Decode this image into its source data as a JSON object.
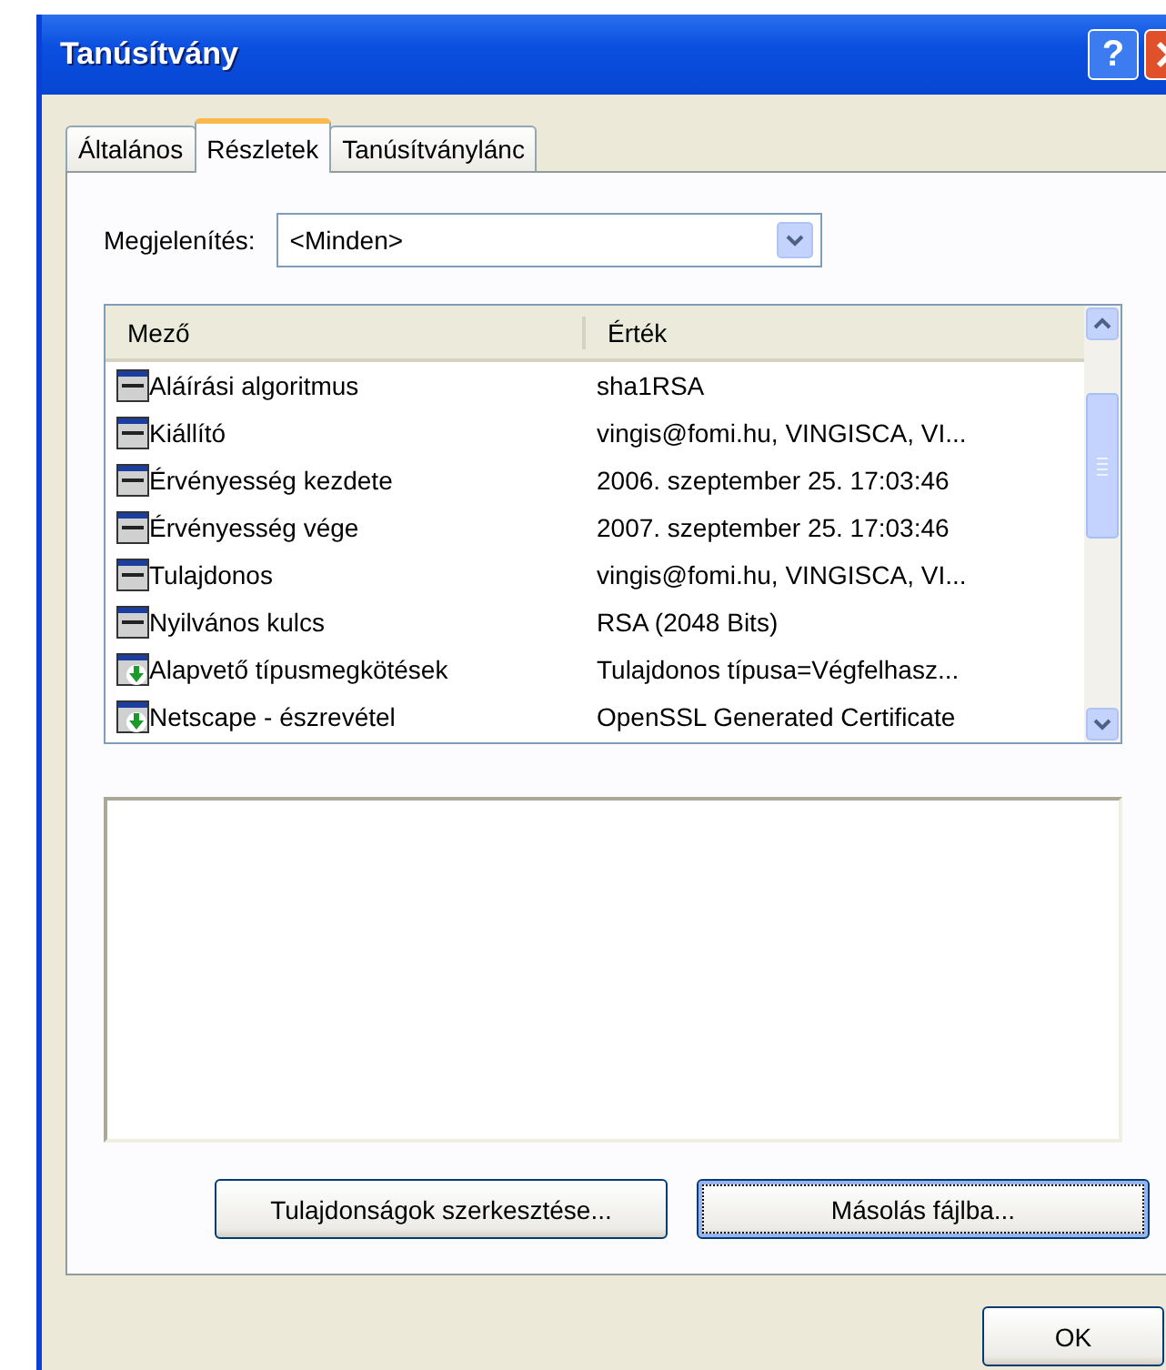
{
  "window": {
    "title": "Tanúsítvány"
  },
  "title_buttons": [
    {
      "kind": "help",
      "label": "?"
    },
    {
      "kind": "close"
    }
  ],
  "tabs": [
    {
      "label": "Általános",
      "selected": false
    },
    {
      "label": "Részletek",
      "selected": true
    },
    {
      "label": "Tanúsítványlánc",
      "selected": false
    }
  ],
  "show": {
    "label": "Megjelenítés:",
    "value": "<Minden>"
  },
  "table": {
    "columns": [
      "Mező",
      "Érték"
    ],
    "rows": [
      {
        "kind": "attribute",
        "field": "Aláírási algoritmus",
        "value": "sha1RSA"
      },
      {
        "kind": "attribute",
        "field": "Kiállító",
        "value": "vingis@fomi.hu, VINGISCA, VI..."
      },
      {
        "kind": "attribute",
        "field": "Érvényesség kezdete",
        "value": "2006. szeptember 25. 17:03:46"
      },
      {
        "kind": "attribute",
        "field": "Érvényesség vége",
        "value": "2007. szeptember 25. 17:03:46"
      },
      {
        "kind": "attribute",
        "field": "Tulajdonos",
        "value": "vingis@fomi.hu, VINGISCA, VI..."
      },
      {
        "kind": "attribute",
        "field": "Nyilvános kulcs",
        "value": "RSA (2048 Bits)"
      },
      {
        "kind": "extension",
        "field": "Alapvető típusmegkötések",
        "value": "Tulajdonos típusa=Végfelhasz..."
      },
      {
        "kind": "extension",
        "field": "Netscape - észrevétel",
        "value": "OpenSSL Generated Certificate"
      }
    ]
  },
  "buttons": [
    {
      "label": "Tulajdonságok szerkesztése...",
      "focused": false
    },
    {
      "label": "Másolás fájlba...",
      "focused": true
    }
  ],
  "footer_buttons": [
    "OK"
  ]
}
